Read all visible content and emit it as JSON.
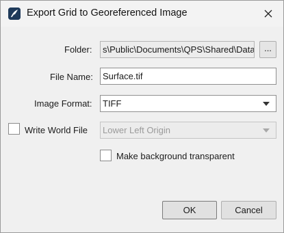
{
  "window": {
    "title": "Export Grid to Georeferenced Image",
    "icon": "app-icon",
    "close_icon": "close-icon"
  },
  "form": {
    "folder": {
      "label": "Folder:",
      "value": "s\\Public\\Documents\\QPS\\Shared\\Data",
      "browse_label": "..."
    },
    "file_name": {
      "label": "File Name:",
      "value": "Surface.tif"
    },
    "image_format": {
      "label": "Image Format:",
      "selected": "TIFF"
    },
    "world_file": {
      "label": "Write World File",
      "checked": false,
      "origin_selected": "Lower Left Origin"
    },
    "transparent": {
      "label": "Make background transparent",
      "checked": false
    }
  },
  "buttons": {
    "ok_label": "OK",
    "cancel_label": "Cancel"
  },
  "colors": {
    "background": "#f0f0f0",
    "field_border": "#8f8f8f",
    "disabled_text": "#9a9a9a"
  }
}
